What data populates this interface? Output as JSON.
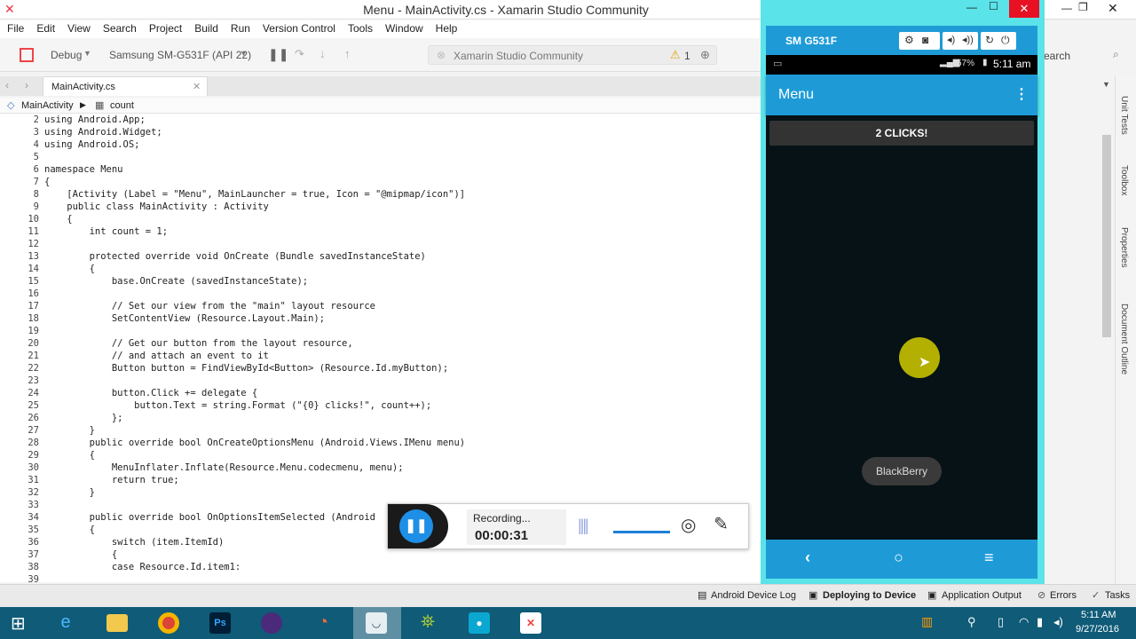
{
  "window": {
    "title": "Menu - MainActivity.cs - Xamarin Studio Community"
  },
  "menu": [
    "File",
    "Edit",
    "View",
    "Search",
    "Project",
    "Build",
    "Run",
    "Version Control",
    "Tools",
    "Window",
    "Help"
  ],
  "toolbar": {
    "config": "Debug",
    "device": "Samsung SM-G531F (API 22)",
    "status": "Xamarin Studio Community",
    "warning_count": "1",
    "search_placeholder": "earch"
  },
  "tab": {
    "label": "MainActivity.cs"
  },
  "path": {
    "class": "MainActivity",
    "member": "count"
  },
  "code": [
    {
      "n": "2",
      "t": "using Android.App;"
    },
    {
      "n": "3",
      "t": "using Android.Widget;"
    },
    {
      "n": "4",
      "t": "using Android.OS;"
    },
    {
      "n": "5",
      "t": ""
    },
    {
      "n": "6",
      "t": "namespace Menu"
    },
    {
      "n": "7",
      "t": "{"
    },
    {
      "n": "8",
      "t": "    [Activity (Label = \"Menu\", MainLauncher = true, Icon = \"@mipmap/icon\")]"
    },
    {
      "n": "9",
      "t": "    public class MainActivity : Activity"
    },
    {
      "n": "10",
      "t": "    {"
    },
    {
      "n": "11",
      "t": "        int count = 1;"
    },
    {
      "n": "12",
      "t": ""
    },
    {
      "n": "13",
      "t": "        protected override void OnCreate (Bundle savedInstanceState)"
    },
    {
      "n": "14",
      "t": "        {"
    },
    {
      "n": "15",
      "t": "            base.OnCreate (savedInstanceState);"
    },
    {
      "n": "16",
      "t": ""
    },
    {
      "n": "17",
      "t": "            // Set our view from the \"main\" layout resource"
    },
    {
      "n": "18",
      "t": "            SetContentView (Resource.Layout.Main);"
    },
    {
      "n": "19",
      "t": ""
    },
    {
      "n": "20",
      "t": "            // Get our button from the layout resource,"
    },
    {
      "n": "21",
      "t": "            // and attach an event to it"
    },
    {
      "n": "22",
      "t": "            Button button = FindViewById<Button> (Resource.Id.myButton);"
    },
    {
      "n": "23",
      "t": ""
    },
    {
      "n": "24",
      "t": "            button.Click += delegate {"
    },
    {
      "n": "25",
      "t": "                button.Text = string.Format (\"{0} clicks!\", count++);"
    },
    {
      "n": "26",
      "t": "            };"
    },
    {
      "n": "27",
      "t": "        }"
    },
    {
      "n": "28",
      "t": "        public override bool OnCreateOptionsMenu (Android.Views.IMenu menu)"
    },
    {
      "n": "29",
      "t": "        {"
    },
    {
      "n": "30",
      "t": "            MenuInflater.Inflate(Resource.Menu.codecmenu, menu);"
    },
    {
      "n": "31",
      "t": "            return true;"
    },
    {
      "n": "32",
      "t": "        }"
    },
    {
      "n": "33",
      "t": ""
    },
    {
      "n": "34",
      "t": "        public override bool OnOptionsItemSelected (Android"
    },
    {
      "n": "35",
      "t": "        {"
    },
    {
      "n": "36",
      "t": "            switch (item.ItemId)"
    },
    {
      "n": "37",
      "t": "            {"
    },
    {
      "n": "38",
      "t": "            case Resource.Id.item1:"
    },
    {
      "n": "39",
      "t": ""
    }
  ],
  "emulator": {
    "device_name": "SM G531F",
    "battery": "57%",
    "time": "5:11 am",
    "app_title": "Menu",
    "button_label": "2 CLICKS!",
    "toast": "BlackBerry"
  },
  "recorder": {
    "status": "Recording...",
    "elapsed": "00:00:31"
  },
  "dock": [
    "Unit Tests",
    "Toolbox",
    "Properties",
    "Document Outline"
  ],
  "status": {
    "device_log": "Android Device Log",
    "deploying": "Deploying to Device",
    "app_output": "Application Output",
    "errors": "Errors",
    "tasks": "Tasks"
  },
  "taskbar": {
    "time": "5:11 AM",
    "date": "9/27/2016"
  },
  "colors": {
    "accent": "#2196f3",
    "android_bar": "#1e9bd7",
    "status_bar_bg": "#0f5b78"
  }
}
